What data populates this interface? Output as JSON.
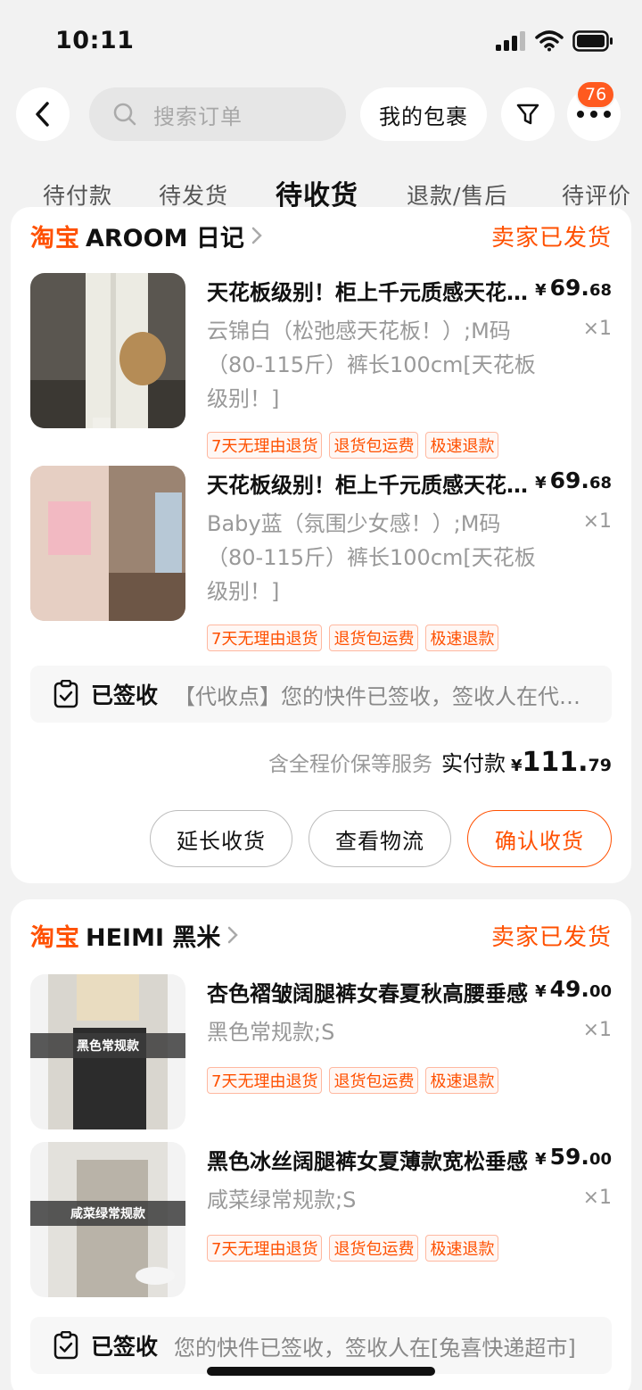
{
  "status": {
    "time": "10:11"
  },
  "header": {
    "search_placeholder": "搜索订单",
    "my_packages": "我的包裹",
    "badge_count": "76"
  },
  "tabs": [
    {
      "label": "待付款"
    },
    {
      "label": "待发货"
    },
    {
      "label": "待收货"
    },
    {
      "label": "退款/售后"
    },
    {
      "label": "待评价"
    }
  ],
  "orders": [
    {
      "brand": "淘宝",
      "shop": "AROOM 日记",
      "status": "卖家已发货",
      "items": [
        {
          "title": "天花板级别！柜上千元质感天花板阔腿裤",
          "price_cur": "¥",
          "price_int": "69.",
          "price_dec": "68",
          "sku": "云锦白（松弛感天花板！）;M码（80-115斤）裤长100cm[天花板级别！]",
          "qty": "×1",
          "tags": [
            "7天无理由退货",
            "退货包运费",
            "极速退款"
          ]
        },
        {
          "title": "天花板级别！柜上千元质感天花板阔腿裤",
          "price_cur": "¥",
          "price_int": "69.",
          "price_dec": "68",
          "sku": "Baby蓝（氛围少女感！）;M码（80-115斤）裤长100cm[天花板级别！]",
          "qty": "×1",
          "tags": [
            "7天无理由退货",
            "退货包运费",
            "极速退款"
          ]
        }
      ],
      "logistics_label": "已签收",
      "logistics_text": "【代收点】您的快件已签收，签收人在代收点",
      "total": {
        "service": "含全程价保等服务",
        "label": "实付款",
        "cur": "¥",
        "int": "111.",
        "dec": "79"
      },
      "buttons": {
        "extend": "延长收货",
        "track": "查看物流",
        "confirm": "确认收货"
      }
    },
    {
      "brand": "淘宝",
      "shop": "HEIMI 黑米",
      "status": "卖家已发货",
      "items": [
        {
          "title": "杏色褶皱阔腿裤女春夏秋高腰垂感",
          "price_cur": "¥",
          "price_int": "49.",
          "price_dec": "00",
          "sku": "黑色常规款;S",
          "qty": "×1",
          "thumb_label": "黑色常规款",
          "tags": [
            "7天无理由退货",
            "退货包运费",
            "极速退款"
          ]
        },
        {
          "title": "黑色冰丝阔腿裤女夏薄款宽松垂感",
          "price_cur": "¥",
          "price_int": "59.",
          "price_dec": "00",
          "sku": "咸菜绿常规款;S",
          "qty": "×1",
          "thumb_label": "咸菜绿常规款",
          "tags": [
            "7天无理由退货",
            "退货包运费",
            "极速退款"
          ]
        }
      ],
      "logistics_label": "已签收",
      "logistics_text": "您的快件已签收，签收人在[兔喜快递超市]"
    }
  ],
  "colors": {
    "accent": "#ff5000",
    "badge": "#ff5a1f",
    "bg": "#f2f2f2"
  }
}
